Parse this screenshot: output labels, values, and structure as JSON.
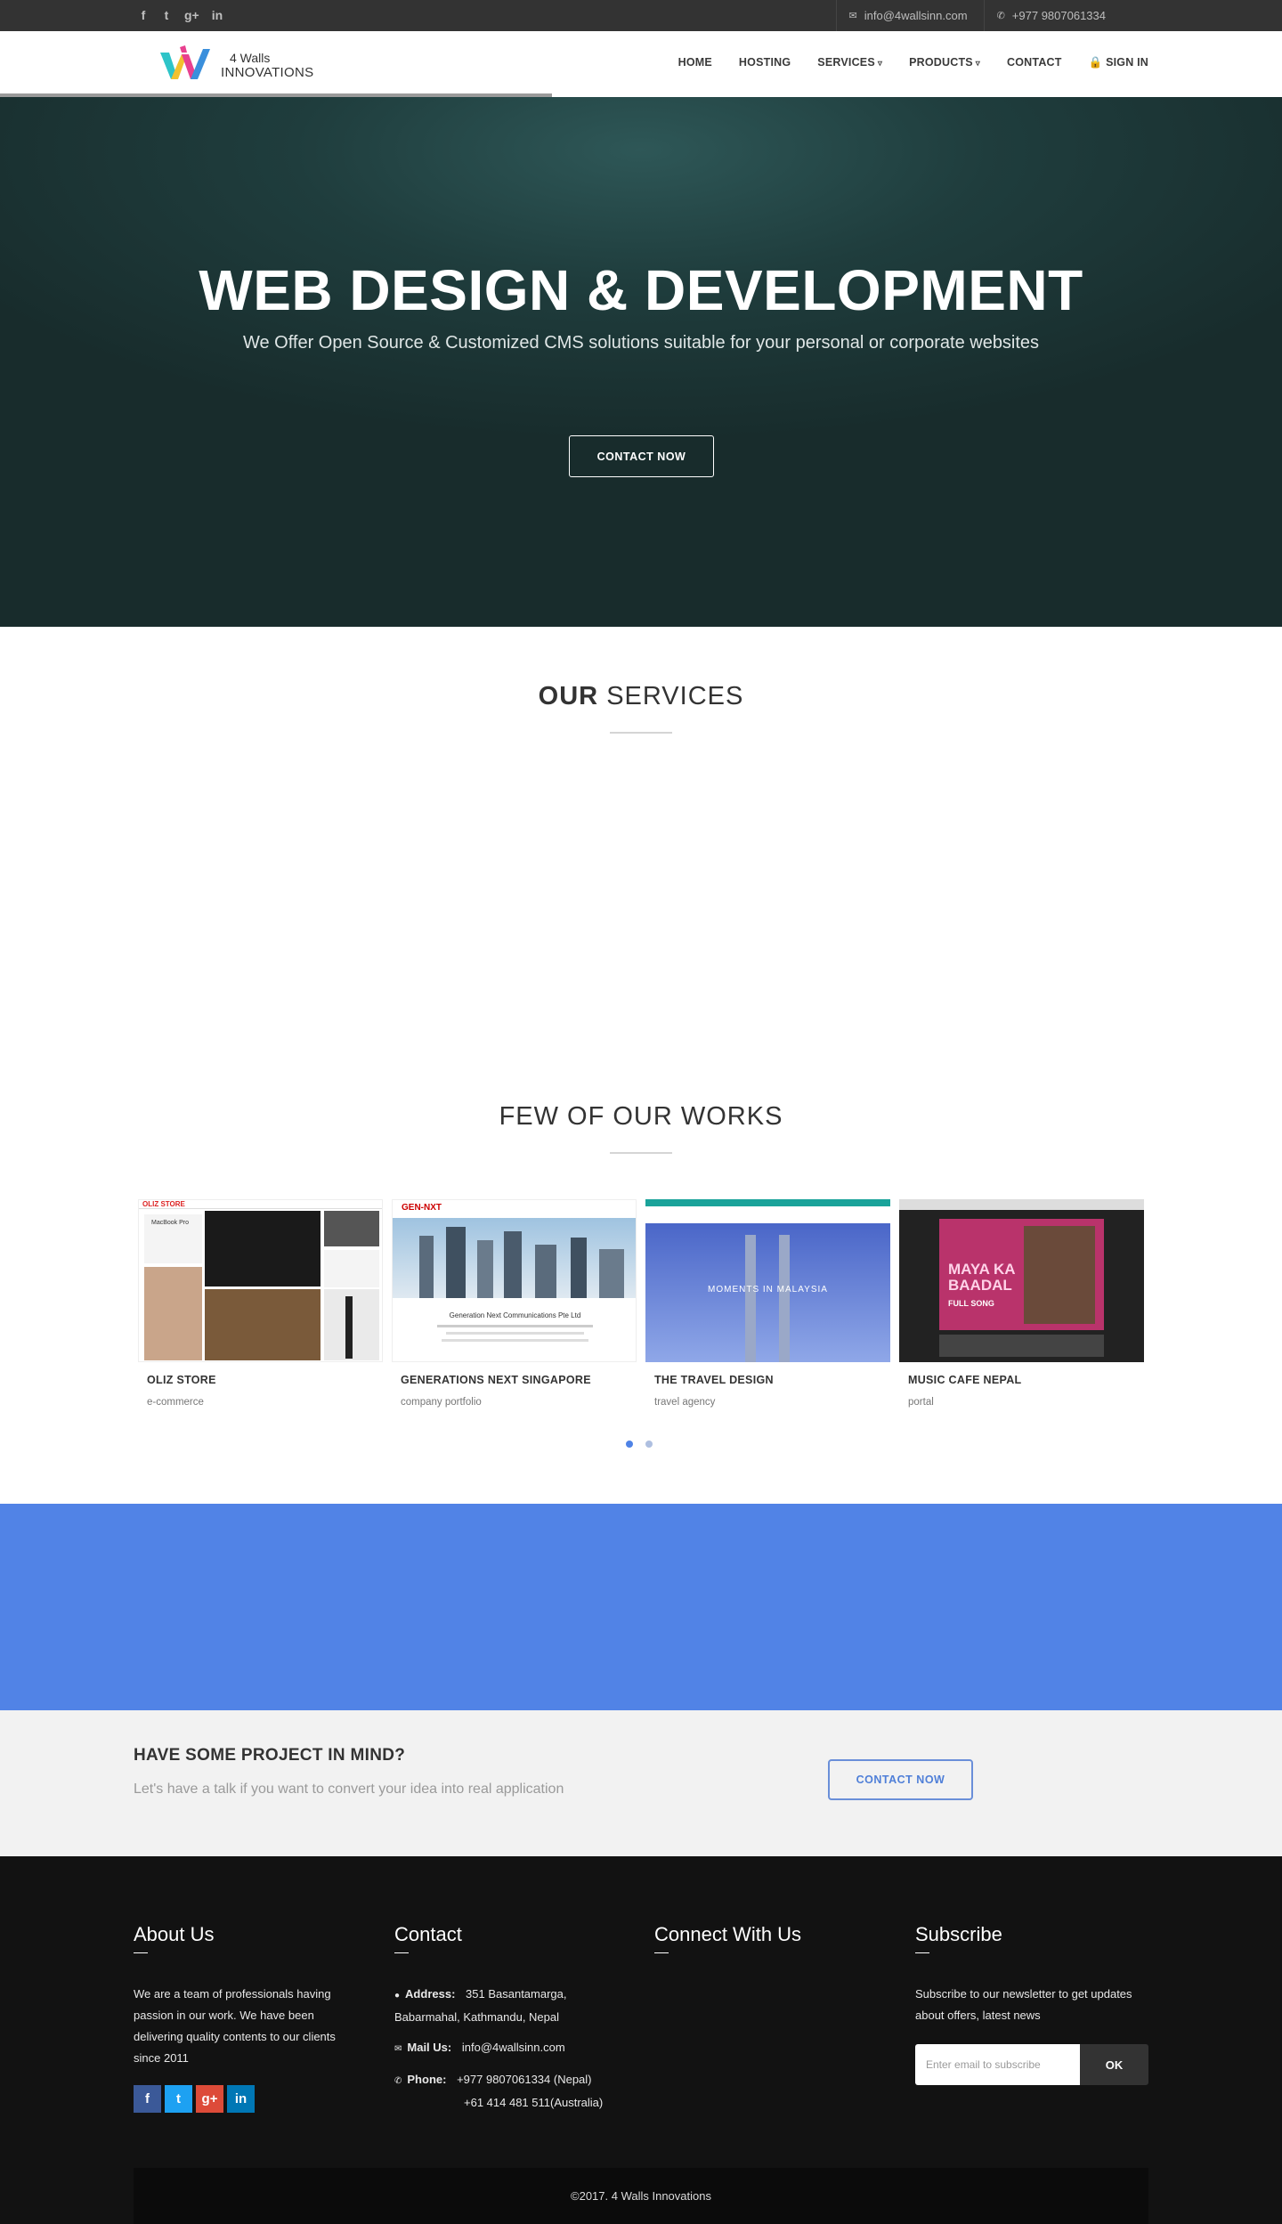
{
  "topbar": {
    "social": [
      {
        "icon": "facebook-icon",
        "glyph": "f"
      },
      {
        "icon": "twitter-icon",
        "glyph": "t"
      },
      {
        "icon": "google-plus-icon",
        "glyph": "g+"
      },
      {
        "icon": "linkedin-icon",
        "glyph": "in"
      }
    ],
    "email": "info@4wallsinn.com",
    "phone": "+977 9807061334"
  },
  "logo": {
    "line1": "4 Walls",
    "line2": "INNOVATIONS"
  },
  "nav": {
    "items": [
      {
        "label": "HOME"
      },
      {
        "label": "HOSTING"
      },
      {
        "label": "SERVICES"
      },
      {
        "label": "PRODUCTS"
      },
      {
        "label": "CONTACT"
      },
      {
        "label": "SIGN IN",
        "icon": "lock-icon"
      }
    ]
  },
  "hero": {
    "title": "WEB DESIGN & DEVELOPMENT",
    "subtitle": "We Offer Open Source & Customized CMS solutions suitable for your personal or corporate websites",
    "button": "CONTACT NOW"
  },
  "services": {
    "title_bold": "OUR",
    "title_rest": "SERVICES"
  },
  "works": {
    "title": "FEW OF OUR WORKS",
    "items": [
      {
        "name": "OLIZ STORE",
        "category": "e-commerce"
      },
      {
        "name": "GENERATIONS NEXT SINGAPORE",
        "category": "company portfolio"
      },
      {
        "name": "THE TRAVEL DESIGN",
        "category": "travel agency"
      },
      {
        "name": "MUSIC CAFE NEPAL",
        "category": "portal"
      }
    ],
    "thumb_text": {
      "oliz": "OLIZ STORE",
      "oliz_sub": "MacBook Pro",
      "gen_logo": "GEN-NXT",
      "gen_caption": "Generation Next Communications Pte Ltd",
      "travel_caption": "MOMENTS IN MALAYSIA",
      "music_title": "MAYA KA BAADAL",
      "music_sub": "FULL SONG"
    },
    "pagination": {
      "pages": 2,
      "active": 0
    }
  },
  "cta": {
    "title": "HAVE SOME PROJECT IN MIND?",
    "text": "Let's have a talk if you want to convert your idea into real application",
    "button": "CONTACT NOW"
  },
  "footer": {
    "about": {
      "title": "About Us",
      "text": "We are a team of professionals having passion in our work. We have been delivering quality contents to our clients since 2011"
    },
    "contact": {
      "title": "Contact",
      "address_label": "Address:",
      "address": "351 Basantamarga, Babarmahal, Kathmandu, Nepal",
      "mail_label": "Mail Us:",
      "mail": "info@4wallsinn.com",
      "phone_label": "Phone:",
      "phone1": "+977 9807061334 (Nepal)",
      "phone2": "+61 414 481 511(Australia)"
    },
    "connect": {
      "title": "Connect With Us"
    },
    "subscribe": {
      "title": "Subscribe",
      "text": "Subscribe to our newsletter to get updates about offers, latest news",
      "placeholder": "Enter email to subscribe",
      "button": "OK"
    },
    "copyright": "©2017. 4 Walls Innovations"
  },
  "colors": {
    "accent": "#5183e6",
    "topbar": "#333333",
    "footer": "#121212",
    "hero": "#1f3d3d"
  }
}
